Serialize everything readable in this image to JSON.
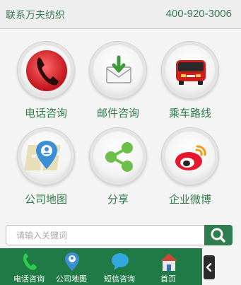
{
  "header": {
    "title": "联系万夫纺织",
    "phone": "400-920-3006"
  },
  "grid": [
    {
      "label": "电话咨询",
      "icon": "phone-icon"
    },
    {
      "label": "邮件咨询",
      "icon": "mail-icon"
    },
    {
      "label": "乘车路线",
      "icon": "bus-icon"
    },
    {
      "label": "公司地图",
      "icon": "map-pin-icon"
    },
    {
      "label": "分享",
      "icon": "share-icon"
    },
    {
      "label": "企业微博",
      "icon": "weibo-icon"
    }
  ],
  "search": {
    "placeholder": "请输入关键词",
    "value": ""
  },
  "footer": {
    "items": [
      {
        "label": "电话咨询",
        "icon": "phone-icon"
      },
      {
        "label": "公司地图",
        "icon": "map-pin-icon"
      },
      {
        "label": "短信咨询",
        "icon": "chat-bubble-icon"
      },
      {
        "label": "首页",
        "icon": "home-icon"
      }
    ]
  },
  "colors": {
    "brand_green": "#2e7d4f",
    "footer_green": "#1f7a45",
    "text_green": "#3c7a55"
  }
}
